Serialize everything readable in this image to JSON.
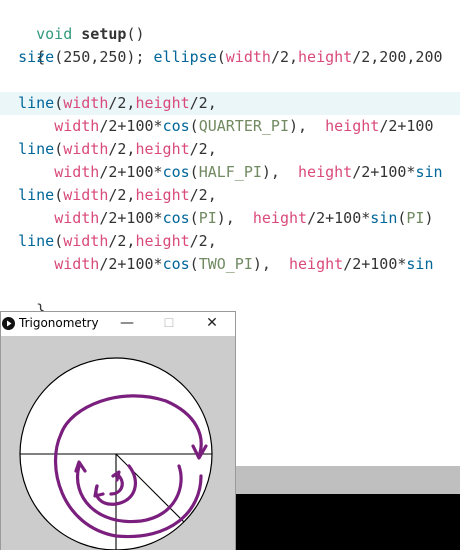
{
  "code": {
    "line1": {
      "kw": "void",
      "fn": "setup",
      "rest": "()"
    },
    "line2": "{",
    "line3": {
      "fn1": "size",
      "args1": "(250,250); ",
      "fn2": "ellipse",
      "open": "(",
      "w": "width",
      "a1": "/2,",
      "h": "height",
      "a2": "/2,200,200"
    },
    "line5": {
      "fn": "line",
      "open": "(",
      "w": "width",
      "a1": "/2,",
      "h": "height",
      "a2": "/2,"
    },
    "line6": {
      "w": "width",
      "a1": "/2+100*",
      "cos": "cos",
      "c": "QUARTER_PI",
      "mid": "),  ",
      "h": "height",
      "a2": "/2+100"
    },
    "line7": {
      "fn": "line",
      "open": "(",
      "w": "width",
      "a1": "/2,",
      "h": "height",
      "a2": "/2,"
    },
    "line8": {
      "w": "width",
      "a1": "/2+100*",
      "cos": "cos",
      "c": "HALF_PI",
      "mid": "),  ",
      "h": "height",
      "a2": "/2+100*",
      "sin": "sin"
    },
    "line9": {
      "fn": "line",
      "open": "(",
      "w": "width",
      "a1": "/2,",
      "h": "height",
      "a2": "/2,"
    },
    "line10": {
      "w": "width",
      "a1": "/2+100*",
      "cos": "cos",
      "c": "PI",
      "mid": "),  ",
      "h": "height",
      "a2": "/2+100*",
      "sin": "sin",
      "c2": "PI",
      "end": ")"
    },
    "line11": {
      "fn": "line",
      "open": "(",
      "w": "width",
      "a1": "/2,",
      "h": "height",
      "a2": "/2,"
    },
    "line12": {
      "w": "width",
      "a1": "/2+100*",
      "cos": "cos",
      "c": "TWO_PI",
      "mid": "),  ",
      "h": "height",
      "a2": "/2+100*",
      "sin": "sin"
    },
    "line13": "}"
  },
  "sketch_window": {
    "title": "Trigonometry",
    "minimize": "—",
    "maximize": "☐",
    "close": "✕",
    "play_icon": "play-icon"
  },
  "colors": {
    "keyword": "#33997e",
    "function": "#006699",
    "constant": "#718a62",
    "variable": "#d94a7a",
    "annotation": "#7b1f7f"
  }
}
